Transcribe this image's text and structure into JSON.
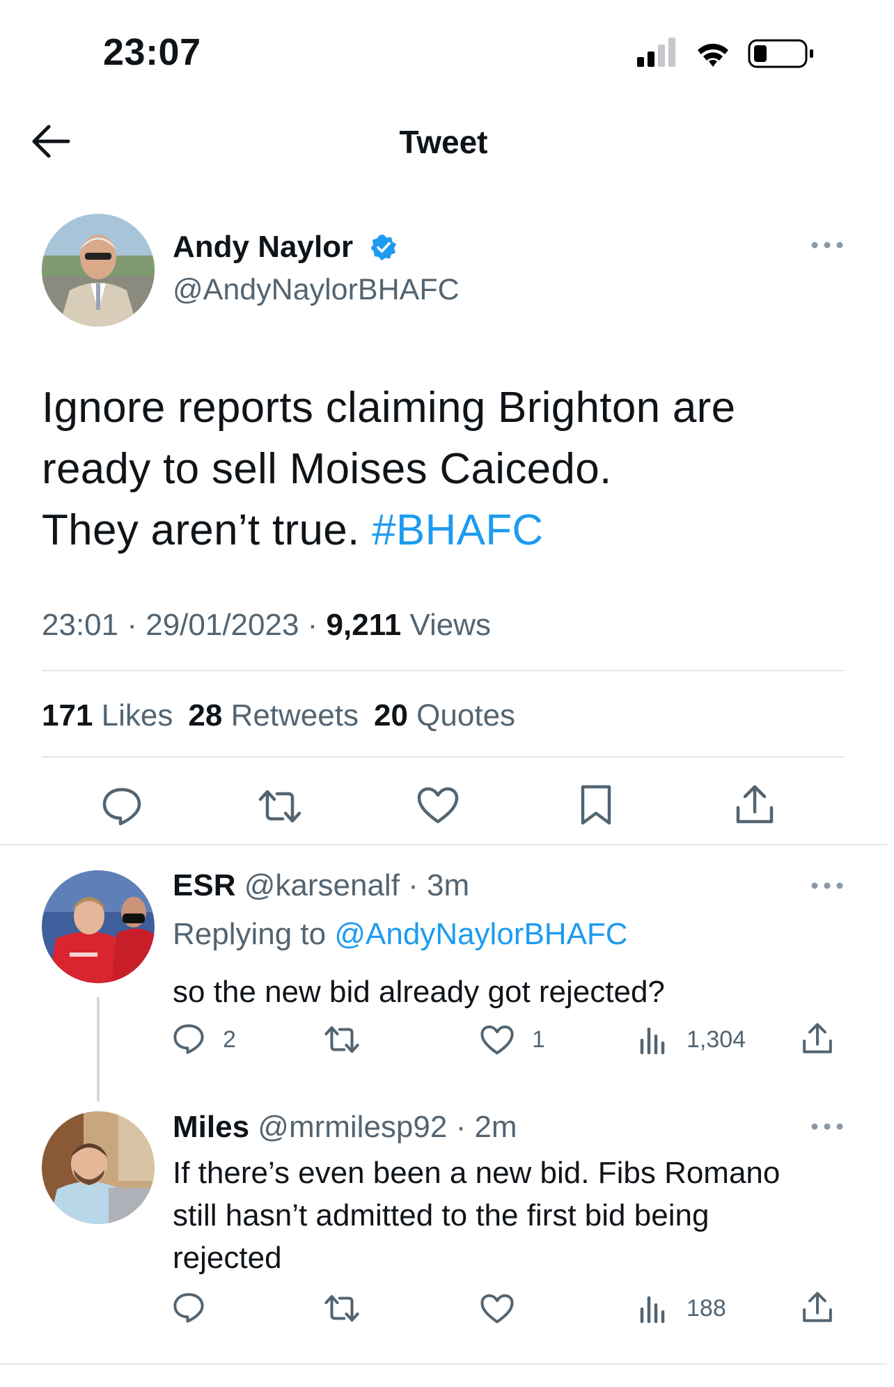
{
  "status_bar": {
    "time": "23:07",
    "icons": [
      "signal-icon",
      "wifi-icon",
      "battery-icon"
    ]
  },
  "header": {
    "title": "Tweet",
    "back_icon": "back-arrow-icon"
  },
  "tweet": {
    "author_name": "Andy Naylor",
    "handle": "@AndyNaylorBHAFC",
    "verified": true,
    "text_lines": [
      "Ignore reports claiming Brighton are",
      "ready to sell Moises Caicedo.",
      "They aren’t true. "
    ],
    "hashtag": "#BHAFC",
    "time": "23:01",
    "date": "29/01/2023",
    "views_count": "9,211",
    "views_label": "Views",
    "separator": " · ",
    "likes_count": "171",
    "likes_label": "Likes",
    "retweets_count": "28",
    "retweets_label": "Retweets",
    "quotes_count": "20",
    "quotes_label": "Quotes",
    "actions": [
      "reply-icon",
      "retweet-icon",
      "like-icon",
      "bookmark-icon",
      "share-icon"
    ]
  },
  "replies": [
    {
      "name": "ESR",
      "handle": "@karsenalf",
      "age": "· 3m",
      "replying_prefix": "Replying to ",
      "replying_to": "@AndyNaylorBHAFC",
      "text": "so the new bid already got rejected?",
      "reply_count": "2",
      "retweet_count": "",
      "like_count": "1",
      "view_count": "1,304"
    },
    {
      "name": "Miles",
      "handle": "@mrmilesp92",
      "age": "· 2m",
      "text_lines": [
        "If there’s even been a new bid. Fibs Romano",
        "still hasn’t admitted to the first bid being",
        "rejected"
      ],
      "view_count": "188"
    }
  ],
  "colors": {
    "accent": "#1d9bf0",
    "text": "#0f1419",
    "secondary": "#536471",
    "divider": "#e1e6ea"
  }
}
